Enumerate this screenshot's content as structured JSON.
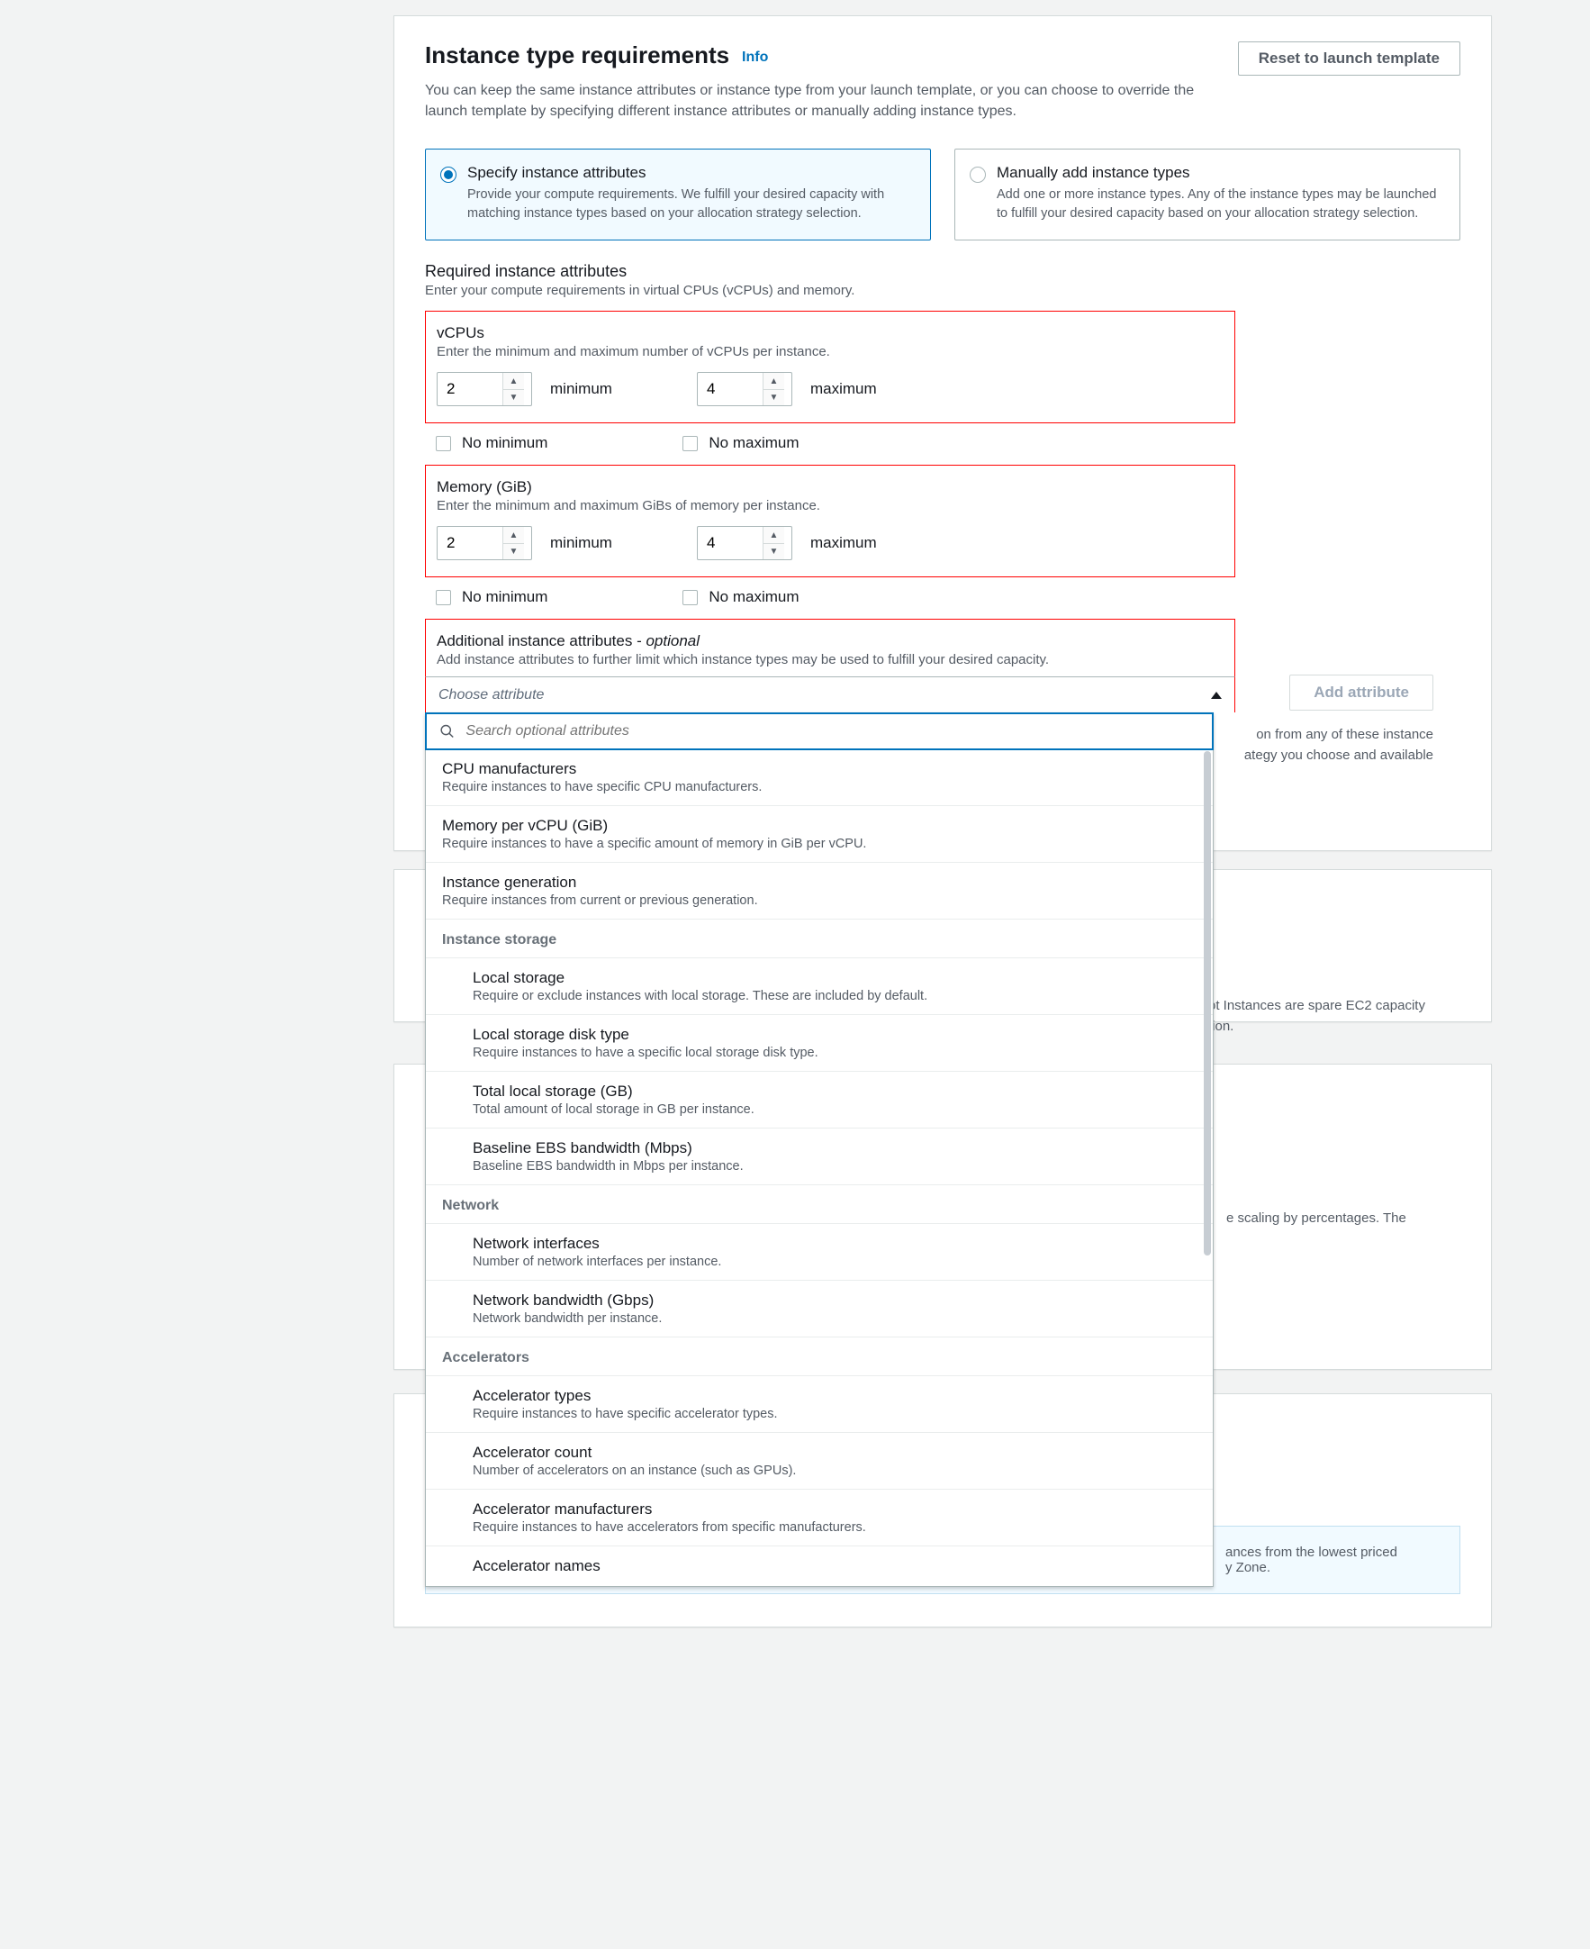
{
  "header": {
    "title": "Instance type requirements",
    "info": "Info",
    "reset_button": "Reset to launch template",
    "description": "You can keep the same instance attributes or instance type from your launch template, or you can choose to override the launch template by specifying different instance attributes or manually adding instance types."
  },
  "tiles": {
    "specify": {
      "title": "Specify instance attributes",
      "desc": "Provide your compute requirements. We fulfill your desired capacity with matching instance types based on your allocation strategy selection."
    },
    "manual": {
      "title": "Manually add instance types",
      "desc": "Add one or more instance types. Any of the instance types may be launched to fulfill your desired capacity based on your allocation strategy selection."
    }
  },
  "required": {
    "heading": "Required instance attributes",
    "desc": "Enter your compute requirements in virtual CPUs (vCPUs) and memory."
  },
  "vcpus": {
    "label": "vCPUs",
    "desc": "Enter the minimum and maximum number of vCPUs per instance.",
    "min_value": "2",
    "max_value": "4",
    "min_label": "minimum",
    "max_label": "maximum",
    "no_min": "No minimum",
    "no_max": "No maximum"
  },
  "memory": {
    "label": "Memory (GiB)",
    "desc": "Enter the minimum and maximum GiBs of memory per instance.",
    "min_value": "2",
    "max_value": "4",
    "min_label": "minimum",
    "max_label": "maximum",
    "no_min": "No minimum",
    "no_max": "No maximum"
  },
  "additional": {
    "heading": "Additional instance attributes - ",
    "optional": "optional",
    "desc": "Add instance attributes to further limit which instance types may be used to fulfill your desired capacity.",
    "choose": "Choose attribute",
    "search_placeholder": "Search optional attributes",
    "add_button": "Add attribute"
  },
  "dropdown": [
    {
      "type": "item",
      "title": "CPU manufacturers",
      "desc": "Require instances to have specific CPU manufacturers."
    },
    {
      "type": "item",
      "title": "Memory per vCPU (GiB)",
      "desc": "Require instances to have a specific amount of memory in GiB per vCPU."
    },
    {
      "type": "item",
      "title": "Instance generation",
      "desc": "Require instances from current or previous generation."
    },
    {
      "type": "group",
      "title": "Instance storage"
    },
    {
      "type": "subitem",
      "title": "Local storage",
      "desc": "Require or exclude instances with local storage. These are included by default."
    },
    {
      "type": "subitem",
      "title": "Local storage disk type",
      "desc": "Require instances to have a specific local storage disk type."
    },
    {
      "type": "subitem",
      "title": "Total local storage (GB)",
      "desc": "Total amount of local storage in GB per instance."
    },
    {
      "type": "subitem",
      "title": "Baseline EBS bandwidth (Mbps)",
      "desc": "Baseline EBS bandwidth in Mbps per instance."
    },
    {
      "type": "group",
      "title": "Network"
    },
    {
      "type": "subitem",
      "title": "Network interfaces",
      "desc": "Number of network interfaces per instance."
    },
    {
      "type": "subitem",
      "title": "Network bandwidth (Gbps)",
      "desc": "Network bandwidth per instance."
    },
    {
      "type": "group",
      "title": "Accelerators"
    },
    {
      "type": "subitem",
      "title": "Accelerator types",
      "desc": "Require instances to have specific accelerator types."
    },
    {
      "type": "subitem",
      "title": "Accelerator count",
      "desc": "Number of accelerators on an instance (such as GPUs)."
    },
    {
      "type": "subitem",
      "title": "Accelerator manufacturers",
      "desc": "Require instances to have accelerators from specific manufacturers."
    },
    {
      "type": "subitem",
      "title": "Accelerator names",
      "desc": ""
    }
  ],
  "behind_text": {
    "line1_right": "on from any of these instance",
    "line2_right": "ategy you choose and available",
    "spot1": "ot Instances are spare EC2 capacity",
    "spot2": "tion.",
    "scaling": "e scaling by percentages. The",
    "blueinfo1": "ances from the lowest priced",
    "blueinfo2": "y Zone."
  }
}
